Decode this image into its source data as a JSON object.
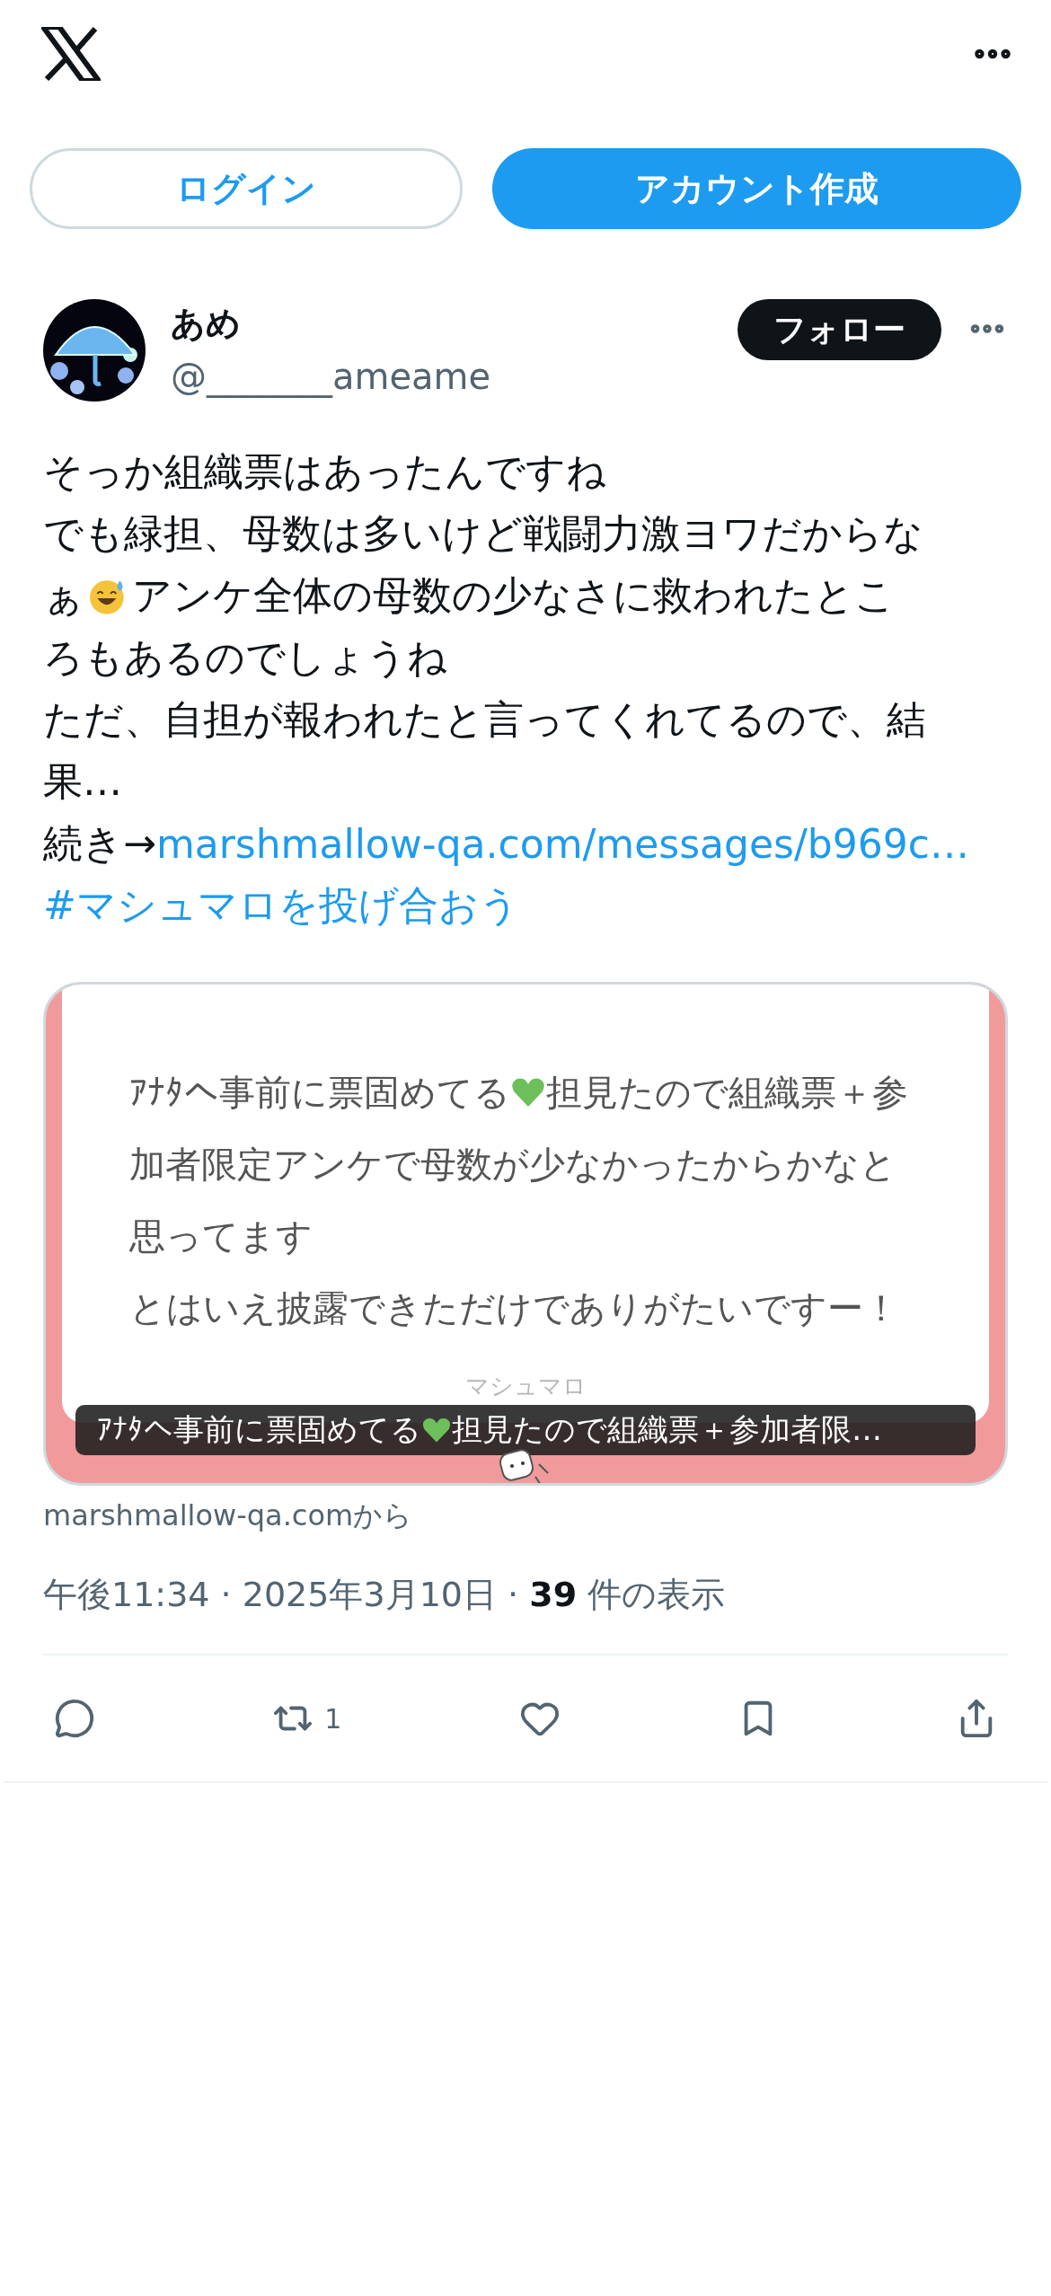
{
  "auth_buttons": [
    {
      "label": "ログイン",
      "kind": "outline"
    },
    {
      "label": "アカウント作成",
      "kind": "primary"
    }
  ],
  "post": {
    "author": {
      "name": "あめ",
      "handle": "@_______ameame"
    },
    "follow_button": "フォロー",
    "body": [
      [
        {
          "kind": "text",
          "text": "そっか組織票はあったんですね"
        }
      ],
      [
        {
          "kind": "text",
          "text": "でも緑担、母数は多いけど戦闘力激ヨワだからな"
        }
      ],
      [
        {
          "kind": "text",
          "text": "ぁ"
        },
        {
          "kind": "smile"
        },
        {
          "kind": "text",
          "text": " アンケ全体の母数の少なさに救われたとこ"
        }
      ],
      [
        {
          "kind": "text",
          "text": "ろもあるのでしょうね"
        }
      ],
      [
        {
          "kind": "text",
          "text": "ただ、自担が報われたと言ってくれてるので、結"
        }
      ],
      [
        {
          "kind": "text",
          "text": "果…"
        }
      ],
      [
        {
          "kind": "text",
          "text": "続き→"
        },
        {
          "kind": "link",
          "text": "marshmallow-qa.com/messages/b969c…"
        }
      ],
      [
        {
          "kind": "link",
          "text": "#マシュマロを投げ合おう"
        }
      ]
    ],
    "card": {
      "lines": [
        [
          {
            "kind": "text",
            "text": "ｱﾅﾀへ事前に票固めてる"
          },
          {
            "kind": "heart"
          },
          {
            "kind": "text",
            "text": "担見たので組織票＋参"
          }
        ],
        [
          {
            "kind": "text",
            "text": "加者限定アンケで母数が少なかったからかなと"
          }
        ],
        [
          {
            "kind": "text",
            "text": "思ってます"
          }
        ],
        [
          {
            "kind": "text",
            "text": "とはいえ披露できただけでありがたいですー！"
          }
        ]
      ],
      "brand": "マシュマロ",
      "caption": [
        {
          "kind": "text",
          "text": "ｱﾅﾀへ事前に票固めてる"
        },
        {
          "kind": "heart"
        },
        {
          "kind": "text",
          "text": "担見たので組織票＋参加者限…"
        }
      ],
      "source": "marshmallow-qa.comから"
    },
    "meta": "午後11:34 · 2025年3月10日 · **39** 件の表示",
    "actions": [
      {
        "kind": "reply"
      },
      {
        "kind": "repost",
        "count": "1"
      },
      {
        "kind": "like"
      },
      {
        "kind": "bookmark"
      },
      {
        "kind": "share"
      }
    ]
  }
}
